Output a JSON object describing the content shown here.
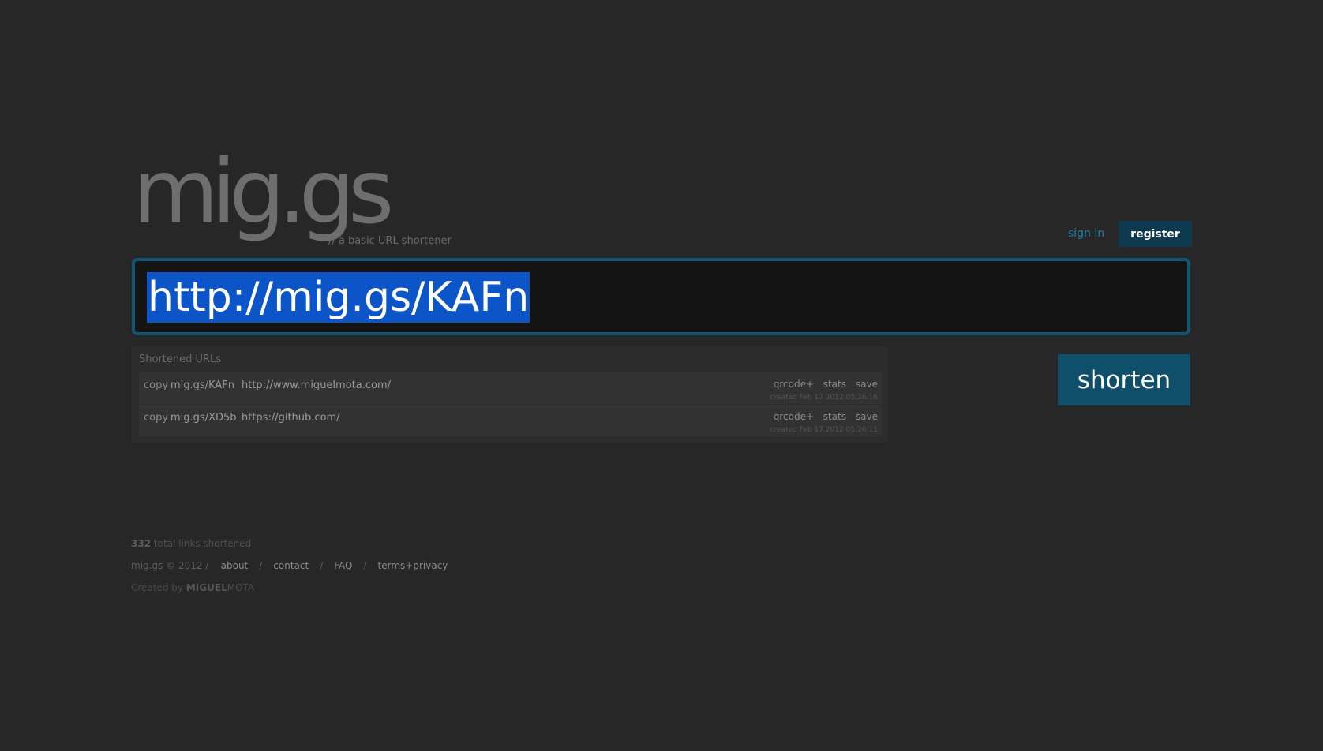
{
  "header": {
    "logo": "mig.gs",
    "tagline": "// a basic URL shortener",
    "signin": "sign in",
    "register": "register"
  },
  "url_input": {
    "value": "http://mig.gs/KAFn"
  },
  "shorten_button": "shorten",
  "shortened": {
    "title": "Shortened URLs",
    "rows": [
      {
        "copy": "copy",
        "short": "mig.gs/KAFn",
        "long": "http://www.miguelmota.com/",
        "qrcode": "qrcode+",
        "stats": "stats",
        "save": "save",
        "created": "created Feb 17 2012 05:26:16"
      },
      {
        "copy": "copy",
        "short": "mig.gs/XD5b",
        "long": "https://github.com/",
        "qrcode": "qrcode+",
        "stats": "stats",
        "save": "save",
        "created": "created Feb 17 2012 05:26:11"
      }
    ]
  },
  "footer": {
    "count": "332",
    "count_text": "total links shortened",
    "copyright": "mig.gs © 2012 /",
    "links": [
      "about",
      "contact",
      "FAQ",
      "terms+privacy"
    ],
    "separator": "/",
    "created_by": "Created by",
    "brand_bold": "MIGUEL",
    "brand_light": "MOTA"
  },
  "colors": {
    "background": "#272727",
    "accent": "#0f4f6b",
    "link": "#1f7fa6",
    "selection": "#0c55c8"
  }
}
